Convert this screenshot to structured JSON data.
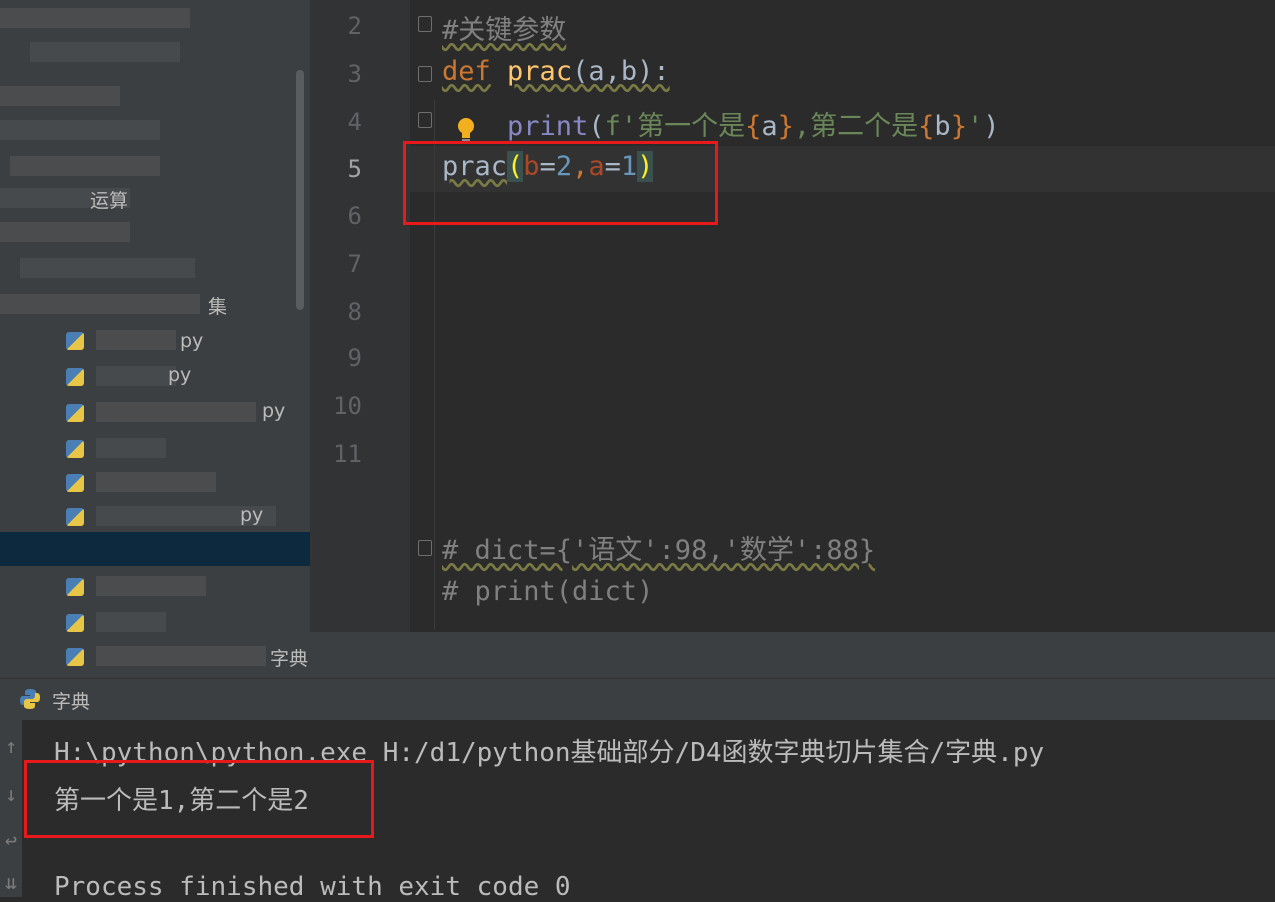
{
  "editor": {
    "line_numbers": [
      "2",
      "3",
      "4",
      "5",
      "6",
      "7",
      "8",
      "9",
      "10",
      "11"
    ],
    "current_line": "5",
    "lines": {
      "l2": {
        "comment": "#关键参数"
      },
      "l3": {
        "kw": "def",
        "fn": "prac",
        "sig": "(a,b):"
      },
      "l4": {
        "builtin": "print",
        "p1": "(",
        "fprefix": "f'",
        "s1": "第一个是",
        "b1": "{",
        "v1": "a",
        "b2": "}",
        "s2": ",第二个是",
        "b3": "{",
        "v2": "b",
        "b4": "}",
        "s3": "'",
        "p2": ")"
      },
      "l5": {
        "fn": "prac",
        "p_open": "(",
        "arg1": "b",
        "eq1": "=",
        "val1": "2",
        "comma": ",",
        "arg2": "a",
        "eq2": "=",
        "val2": "1",
        "p_close": ")"
      },
      "l12": {
        "comment": "# dict={'语文':98,'数学':88}"
      },
      "l13": {
        "comment": "# print(dict)"
      }
    }
  },
  "sidebar": {
    "visible_fragments": [
      "运算",
      "集",
      "py",
      "py",
      "py",
      "py",
      "字典"
    ]
  },
  "run_panel": {
    "tab_label": "字典",
    "command": "H:\\python\\python.exe H:/d1/python基础部分/D4函数字典切片集合/字典.py",
    "output": "第一个是1,第二个是2",
    "exit_message": "Process finished with exit code 0"
  },
  "colors": {
    "highlight_box": "#e8191a",
    "keyword": "#cc7832",
    "function": "#ffc66d",
    "string": "#6a8759",
    "number": "#6897bb",
    "param": "#aa4926"
  },
  "icons": {
    "bulb": "lightbulb-icon",
    "run_tab": "python-icon",
    "side": [
      "arrow-up-icon",
      "arrow-down-icon",
      "soft-wrap-icon",
      "scroll-to-end-icon"
    ]
  }
}
